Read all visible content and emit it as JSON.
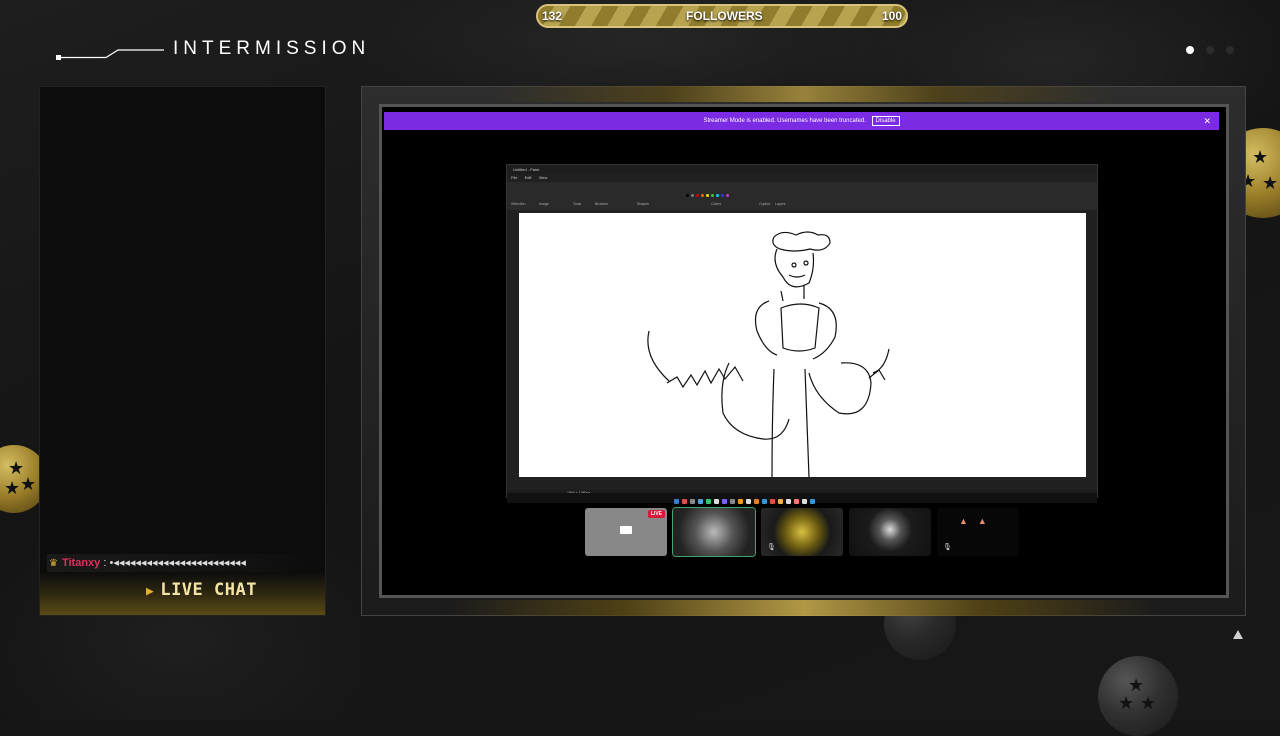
{
  "followers_bar": {
    "current": "132",
    "label": "FOLLOWERS",
    "goal": "100"
  },
  "title": "INTERMISSION",
  "page_dots": {
    "count": 3,
    "active_index": 0
  },
  "chat": {
    "message": {
      "user": "Titanxy",
      "separator": ":",
      "text": "•◂◂◂◂◂◂◂◂◂◂◂◂◂◂◂◂◂◂◂◂◂◂◂◂"
    },
    "footer_label": "LIVE CHAT"
  },
  "stream_window": {
    "banner": {
      "text": "Streamer Mode is enabled. Usernames have been truncated.",
      "button": "Disable",
      "close": "✕"
    },
    "paint": {
      "title": "Untitled - Paint",
      "menu": [
        "File",
        "Edit",
        "View"
      ],
      "tool_groups": [
        "Selection",
        "Image",
        "Tools",
        "Brushes",
        "Shapes",
        "Colors",
        "Copilot",
        "Layers"
      ],
      "status": "1964 × 1080px"
    },
    "tiles": [
      {
        "name": "screen-share",
        "badge": "LIVE"
      },
      {
        "name": "participant-2"
      },
      {
        "name": "participant-3"
      },
      {
        "name": "participant-4"
      },
      {
        "name": "participant-5"
      }
    ]
  },
  "colors": {
    "accent_gold": "#d9c37a",
    "banner_purple": "#7b2be3",
    "chat_username": "#e0305c",
    "live_badge": "#d61b3b"
  }
}
